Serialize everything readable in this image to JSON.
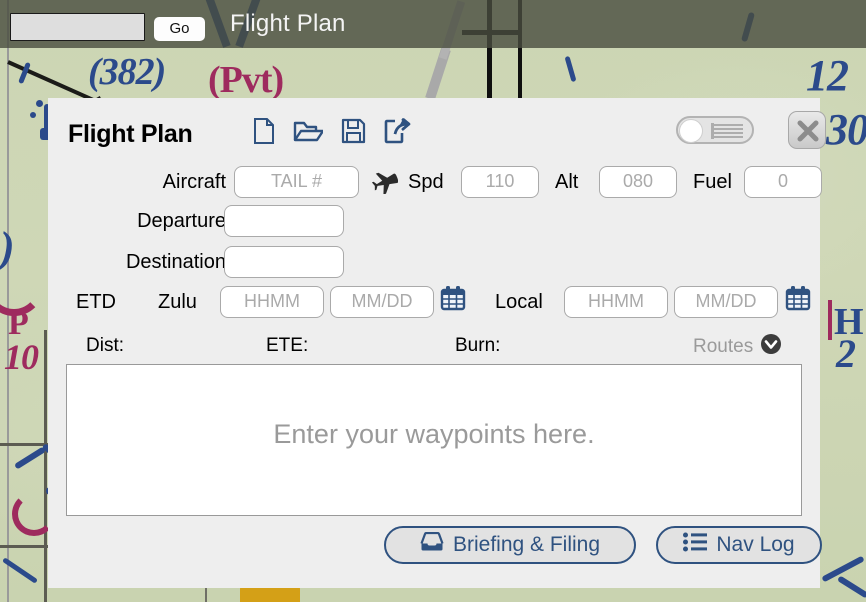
{
  "top_bar": {
    "url_value": "",
    "go_label": "Go",
    "title": "Flight Plan"
  },
  "dialog": {
    "title": "Flight Plan",
    "toolbar": [
      {
        "name": "new-icon",
        "label": "New"
      },
      {
        "name": "open-icon",
        "label": "Open"
      },
      {
        "name": "save-icon",
        "label": "Save"
      },
      {
        "name": "share-icon",
        "label": "Share"
      }
    ],
    "view_toggle": {
      "state": "off",
      "icon": "list-icon"
    },
    "close_label": "Close",
    "fields": {
      "aircraft": {
        "label": "Aircraft",
        "value": "",
        "placeholder": "TAIL #"
      },
      "departure": {
        "label": "Departure",
        "value": "",
        "placeholder": ""
      },
      "destination": {
        "label": "Destination",
        "value": "",
        "placeholder": ""
      },
      "spd": {
        "label": "Spd",
        "value": "",
        "placeholder": "110"
      },
      "alt": {
        "label": "Alt",
        "value": "",
        "placeholder": "080"
      },
      "fuel": {
        "label": "Fuel",
        "value": "",
        "placeholder": "0"
      }
    },
    "etd": {
      "label": "ETD",
      "zulu": {
        "label": "Zulu",
        "time_placeholder": "HHMM",
        "time_value": "",
        "date_placeholder": "MM/DD",
        "date_value": ""
      },
      "local": {
        "label": "Local",
        "time_placeholder": "HHMM",
        "time_value": "",
        "date_placeholder": "MM/DD",
        "date_value": ""
      }
    },
    "summary": {
      "dist": "Dist:",
      "ete": "ETE:",
      "burn": "Burn:",
      "routes": "Routes"
    },
    "waypoints": {
      "value": "",
      "placeholder": "Enter your waypoints here."
    },
    "footer": {
      "briefing": "Briefing & Filing",
      "nav_log": "Nav Log"
    }
  },
  "colors": {
    "accent_blue": "#2f5280",
    "toolbar_blue": "#2f5280",
    "dialog_bg": "#eeeeee",
    "map_green": "#ccd6b4",
    "chart_navy": "#2b4a8b",
    "chart_magenta": "#9e2b5e",
    "placeholder_gray": "#aaaaaa",
    "top_bar": "#484c3e"
  },
  "map_labels": [
    {
      "text": "(382)",
      "color": "navy"
    },
    {
      "text": "(Pvt)",
      "color": "magenta"
    },
    {
      "text": "12",
      "color": "navy"
    },
    {
      "text": "30",
      "color": "navy"
    },
    {
      "text": "P",
      "color": "magenta"
    },
    {
      "text": "10",
      "color": "magenta"
    }
  ]
}
